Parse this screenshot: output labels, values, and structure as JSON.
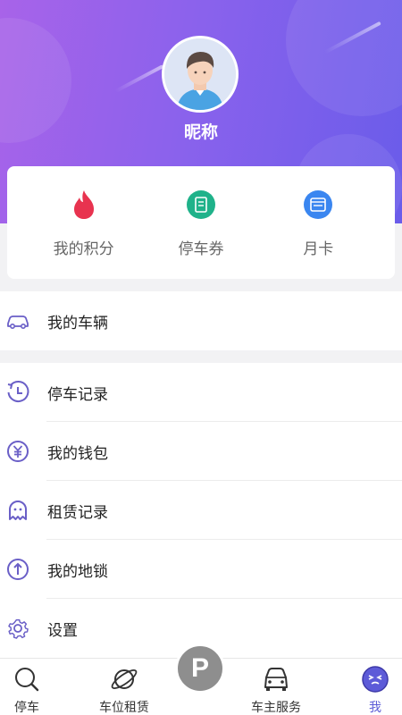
{
  "profile": {
    "nickname": "昵称"
  },
  "stats": [
    {
      "label": "我的积分",
      "icon": "flame-icon",
      "color": "#e8334f"
    },
    {
      "label": "停车券",
      "icon": "coupon-icon",
      "color": "#1fb28a"
    },
    {
      "label": "月卡",
      "icon": "card-icon",
      "color": "#3a86f0"
    }
  ],
  "menu": {
    "vehicles": "我的车辆",
    "parking_records": "停车记录",
    "wallet": "我的钱包",
    "rental_records": "租赁记录",
    "ground_lock": "我的地锁",
    "settings": "设置"
  },
  "tabbar": {
    "parking": "停车",
    "space_rental": "车位租赁",
    "center_button": "P",
    "owner_service": "车主服务",
    "me": "我"
  },
  "colors": {
    "accent": "#5b5bd6",
    "menu_icon": "#6a5fc7"
  }
}
